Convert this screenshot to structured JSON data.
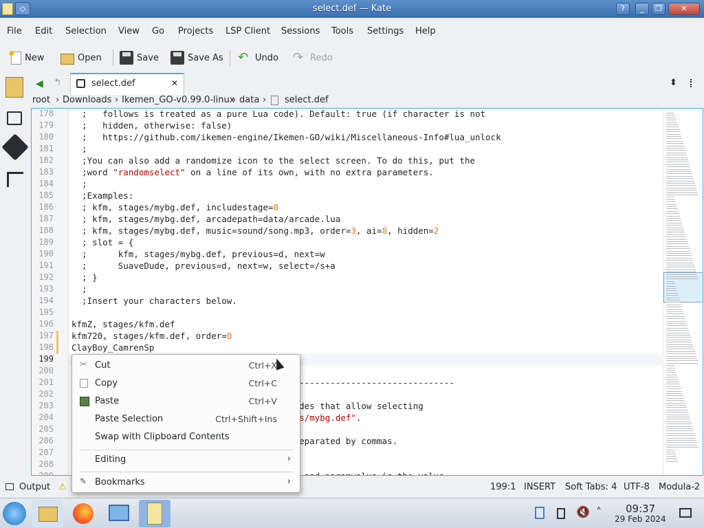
{
  "window": {
    "title": "select.def — Kate",
    "controls": [
      "?",
      "_",
      "❐",
      "✕"
    ]
  },
  "menubar": [
    "File",
    "Edit",
    "Selection",
    "View",
    "Go",
    "Projects",
    "LSP Client",
    "Sessions",
    "Tools",
    "Settings",
    "Help"
  ],
  "toolbar": {
    "new": "New",
    "open": "Open",
    "save": "Save",
    "save_as": "Save As",
    "undo": "Undo",
    "redo": "Redo"
  },
  "tab": {
    "label": "select.def",
    "close": "✕"
  },
  "breadcrumb": [
    "root",
    "Downloads",
    "Ikemen_GO-v0.99.0-linux",
    "data",
    "select.def"
  ],
  "editor": {
    "lines": [
      {
        "n": "178",
        "t": "  ;   follows is treated as a pure Lua code). Default: true (if character is not"
      },
      {
        "n": "179",
        "t": "  ;   hidden, otherwise: false)"
      },
      {
        "n": "180",
        "t": "  ;   https://github.com/ikemen-engine/Ikemen-GO/wiki/Miscellaneous-Info#lua_unlock"
      },
      {
        "n": "181",
        "t": "  ;"
      },
      {
        "n": "182",
        "t": "  ;You can also add a randomize icon to the select screen. To do this, put the"
      },
      {
        "n": "183",
        "a": "  ;word ",
        "s": "\"randomselect\"",
        "b": " on a line of its own, with no extra parameters."
      },
      {
        "n": "184",
        "t": "  ;"
      },
      {
        "n": "185",
        "t": "  ;Examples:"
      },
      {
        "n": "186",
        "a": "  ; kfm, stages/mybg.def, includestage=",
        "u": "0"
      },
      {
        "n": "187",
        "t": "  ; kfm, stages/mybg.def, arcadepath=data/arcade.lua"
      },
      {
        "n": "188",
        "a": "  ; kfm, stages/mybg.def, music=sound/song.mp3, order=",
        "u": "3",
        "b": ", ai=",
        "u2": "8",
        "c": ", hidden=",
        "u3": "2"
      },
      {
        "n": "189",
        "t": "  ; slot = {"
      },
      {
        "n": "190",
        "t": "  ;      kfm, stages/mybg.def, previous=d, next=w"
      },
      {
        "n": "191",
        "t": "  ;      SuaveDude, previous=d, next=w, select=/s+a"
      },
      {
        "n": "192",
        "t": "  ; }"
      },
      {
        "n": "193",
        "t": "  ;"
      },
      {
        "n": "194",
        "t": "  ;Insert your characters below."
      },
      {
        "n": "195",
        "t": ""
      },
      {
        "n": "196",
        "t": "kfmZ, stages/kfm.def"
      },
      {
        "n": "197",
        "a": "kfm720, stages/kfm.def, order=",
        "u": "0"
      },
      {
        "n": "198",
        "t": "ClayBoy_CamrenSp"
      },
      {
        "n": "199",
        "t": ""
      },
      {
        "n": "200",
        "t": ""
      },
      {
        "n": "201",
        "t": "                                  ----------------------------------------"
      },
      {
        "n": "202",
        "t": ""
      },
      {
        "n": "203",
        "t": "                                  able in modes that allow selecting"
      },
      {
        "n": "204",
        "a": "                                  ert ",
        "s": "\"stages/mybg.def\"",
        "b": "."
      },
      {
        "n": "205",
        "t": ""
      },
      {
        "n": "206",
        "t": "                                  ne line, separated by commas."
      },
      {
        "n": "207",
        "t": ""
      },
      {
        "n": "208",
        "t": ""
      },
      {
        "n": "209",
        "t": "                                  ater type, and paramvalue is the value"
      }
    ]
  },
  "context_menu": {
    "items": [
      {
        "label": "Cut",
        "shortcut": "Ctrl+X",
        "icon": "scissors-icon"
      },
      {
        "label": "Copy",
        "shortcut": "Ctrl+C",
        "icon": "copy-icon"
      },
      {
        "label": "Paste",
        "shortcut": "Ctrl+V",
        "icon": "paste-icon"
      },
      {
        "label": "Paste Selection",
        "shortcut": "Ctrl+Shift+Ins"
      },
      {
        "label": "Swap with Clipboard Contents",
        "shortcut": ""
      }
    ],
    "editing": "Editing",
    "bookmarks": "Bookmarks"
  },
  "statusbar": {
    "output": "Output",
    "position": "199:1",
    "mode": "INSERT",
    "tabs": "Soft Tabs: 4",
    "encoding": "UTF-8",
    "syntax": "Modula-2"
  },
  "taskbar": {
    "time": "09:37",
    "date": "29 Feb 2024"
  }
}
